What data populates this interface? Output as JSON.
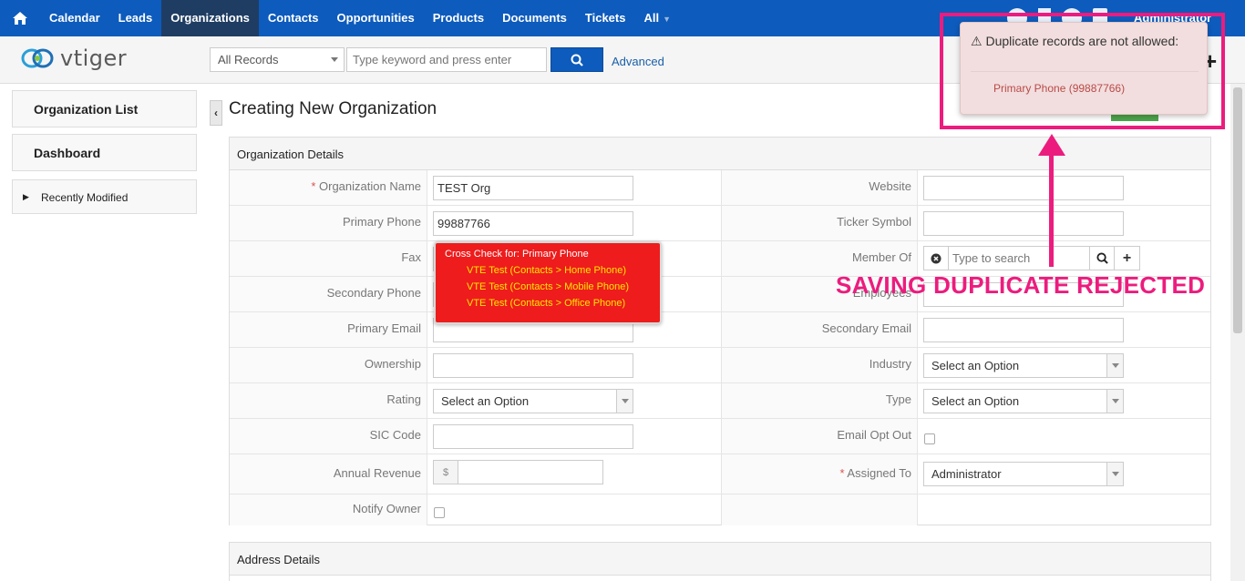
{
  "nav": {
    "items": [
      "Calendar",
      "Leads",
      "Organizations",
      "Contacts",
      "Opportunities",
      "Products",
      "Documents",
      "Tickets",
      "All"
    ],
    "active": "Organizations",
    "user": "Administrator"
  },
  "header": {
    "logo_text": "vtiger",
    "record_filter": "All Records",
    "search_placeholder": "Type keyword and press enter",
    "advanced_label": "Advanced"
  },
  "sidebar": {
    "list_label": "Organization List",
    "dashboard_label": "Dashboard",
    "recent_label": "Recently Modified"
  },
  "page": {
    "title": "Creating New Organization"
  },
  "details": {
    "section_title": "Organization Details",
    "labels": {
      "org_name": "Organization Name",
      "primary_phone": "Primary Phone",
      "fax": "Fax",
      "secondary_phone": "Secondary Phone",
      "primary_email": "Primary Email",
      "ownership": "Ownership",
      "rating": "Rating",
      "sic_code": "SIC Code",
      "annual_revenue": "Annual Revenue",
      "notify_owner": "Notify Owner",
      "website": "Website",
      "ticker_symbol": "Ticker Symbol",
      "member_of": "Member Of",
      "employees": "Employees",
      "secondary_email": "Secondary Email",
      "industry": "Industry",
      "type": "Type",
      "email_opt_out": "Email Opt Out",
      "assigned_to": "Assigned To"
    },
    "values": {
      "org_name": "TEST Org",
      "primary_phone": "99887766",
      "rating": "Select an Option",
      "industry": "Select an Option",
      "type": "Select an Option",
      "assigned_to": "Administrator",
      "member_placeholder": "Type to search",
      "currency_symbol": "$"
    }
  },
  "address": {
    "section_title": "Address Details"
  },
  "crosscheck": {
    "title": "Cross Check for: Primary Phone",
    "matches": [
      {
        "name": "VTE Test",
        "where": "Contacts > Home Phone"
      },
      {
        "name": "VTE Test",
        "where": "Contacts > Mobile Phone"
      },
      {
        "name": "VTE Test",
        "where": "Contacts > Office Phone"
      }
    ]
  },
  "notification": {
    "title": "Duplicate records are not allowed:",
    "item": "Primary Phone (99887766)"
  },
  "annotation": {
    "text": "SAVING DUPLICATE REJECTED",
    "color": "#ec1c7e"
  },
  "colors": {
    "nav_bg": "#0d5bbc",
    "nav_active": "#1f3d63",
    "tooltip_red": "#ee1c1c",
    "alert_bg": "#f2dede"
  }
}
